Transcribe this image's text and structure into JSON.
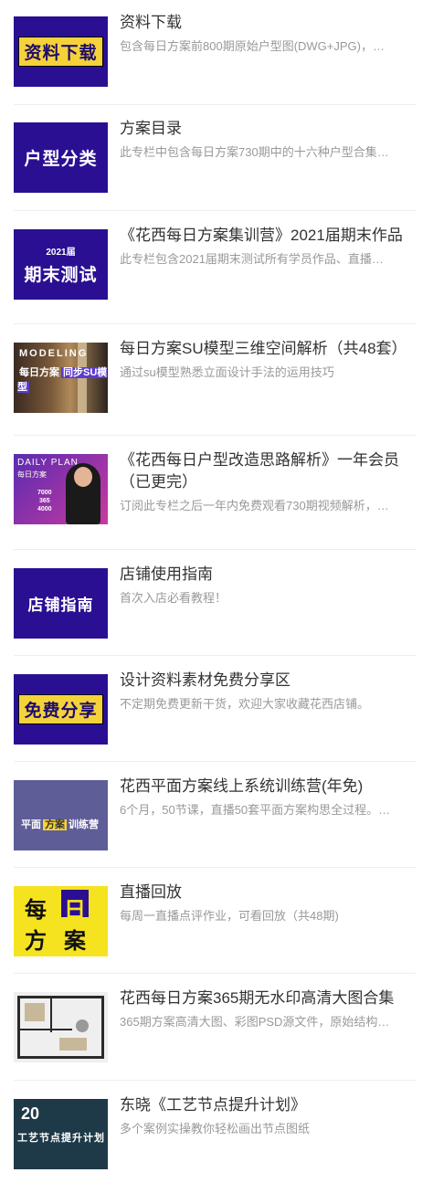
{
  "items": [
    {
      "title": "资料下载",
      "desc": "包含每日方案前800期原始户型图(DWG+JPG)，…",
      "thumb_text": "资料下载",
      "thumb_icon": "download-banner"
    },
    {
      "title": "方案目录",
      "desc": "此专栏中包含每日方案730期中的十六种户型合集…",
      "thumb_text": "户型分类",
      "thumb_icon": "category-banner"
    },
    {
      "title": "《花西每日方案集训营》2021届期末作品",
      "desc": "此专栏包含2021届期末测试所有学员作品、直播…",
      "thumb_small": "2021届",
      "thumb_text": "期末测试",
      "thumb_icon": "exam-banner"
    },
    {
      "title": "每日方案SU模型三维空间解析（共48套）",
      "desc": "通过su模型熟悉立面设计手法的运用技巧",
      "thumb_l1": "MODELING",
      "thumb_l2a": "每日方案",
      "thumb_l2b": "同步SU模型",
      "thumb_icon": "su-model-photo"
    },
    {
      "title": "《花西每日户型改造思路解析》一年会员（已更完）",
      "desc": "订阅此专栏之后一年内免费观看730期视频解析，…",
      "thumb_l1": "DAILY PLAN",
      "thumb_l2": "每日方案",
      "thumb_nums": [
        "7000",
        "365",
        "4000"
      ],
      "thumb_icon": "daily-plan-poster"
    },
    {
      "title": "店铺使用指南",
      "desc": "首次入店必看教程！",
      "thumb_text": "店铺指南",
      "thumb_icon": "guide-banner"
    },
    {
      "title": "设计资料素材免费分享区",
      "desc": "不定期免费更新干货，欢迎大家收藏花西店铺。",
      "thumb_text": "免费分享",
      "thumb_icon": "free-share-banner"
    },
    {
      "title": "花西平面方案线上系统训练营(年免)",
      "desc": "6个月，50节课，直播50套平面方案构思全过程。…",
      "thumb_l2a": "平面",
      "thumb_l2b": "方案",
      "thumb_l2c": "训练营",
      "thumb_icon": "training-camp-banner"
    },
    {
      "title": "直播回放",
      "desc": "每周一直播点评作业，可看回放（共48期)",
      "thumb_chars": [
        "每",
        "日",
        "方",
        "案"
      ],
      "thumb_icon": "daily-plan-logo"
    },
    {
      "title": "花西每日方案365期无水印高清大图合集",
      "desc": "365期方案高清大图、彩图PSD源文件，原始结构…",
      "thumb_icon": "floor-plan-image"
    },
    {
      "title": "东晓《工艺节点提升计划》",
      "desc": "多个案例实操教你轻松画出节点图纸",
      "thumb_l1": "20",
      "thumb_l2": "工艺节点提升计划",
      "thumb_icon": "craft-node-banner"
    }
  ]
}
